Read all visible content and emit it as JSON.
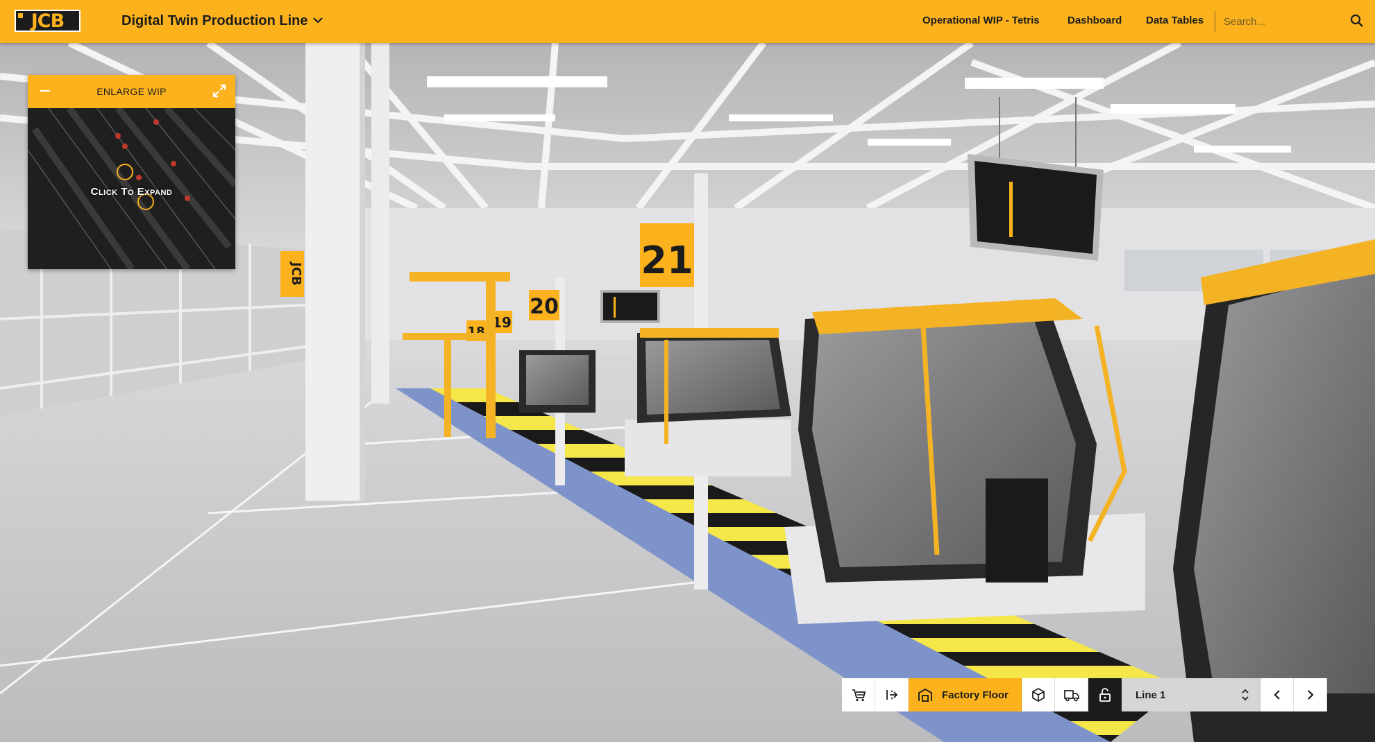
{
  "header": {
    "app_title": "Digital Twin Production Line",
    "logo_text": "JCB",
    "nav": [
      "Operational WIP - Tetris",
      "Dashboard",
      "Data Tables"
    ],
    "search_placeholder": "Search..."
  },
  "wip_panel": {
    "title": "ENLARGE WIP",
    "expand_label": "Click To Expand"
  },
  "scene": {
    "station_signs": [
      "21",
      "20",
      "19",
      "18"
    ],
    "wall_logo": "JCB"
  },
  "toolbar": {
    "buttons": [
      {
        "icon": "cart-icon"
      },
      {
        "icon": "line-flow-icon"
      },
      {
        "icon": "factory-floor-icon",
        "label": "Factory Floor",
        "active": true
      },
      {
        "icon": "cube-icon"
      },
      {
        "icon": "truck-icon"
      }
    ],
    "lock_icon": "unlock-icon",
    "line_select_value": "Line 1"
  },
  "colors": {
    "brand_yellow": "#fbb21d",
    "dark": "#1c1c1c",
    "floor": "#c8c8ca",
    "conveyor_blue": "#7e93c9"
  }
}
